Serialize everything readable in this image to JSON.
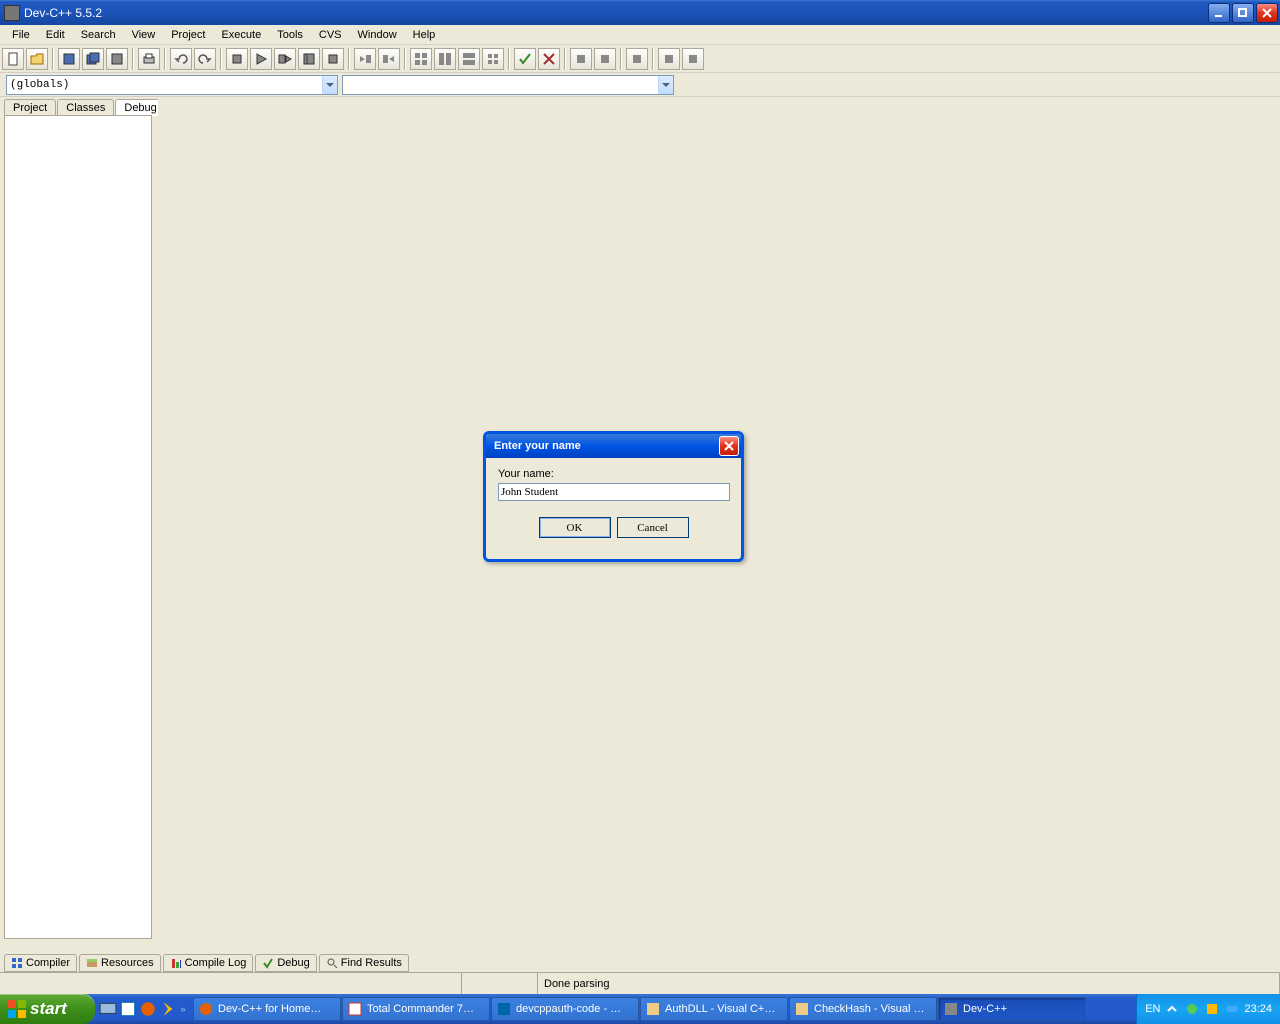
{
  "window": {
    "title": "Dev-C++ 5.5.2",
    "minimize": "_",
    "restore": "❐",
    "close": "×"
  },
  "menu": {
    "items": [
      "File",
      "Edit",
      "Search",
      "View",
      "Project",
      "Execute",
      "Tools",
      "CVS",
      "Window",
      "Help"
    ]
  },
  "toolbar2": {
    "globals": "(globals)",
    "second": ""
  },
  "sideTabs": {
    "project": "Project",
    "classes": "Classes",
    "debug": "Debug"
  },
  "bottomTabs": {
    "compiler": "Compiler",
    "resources": "Resources",
    "compileLog": "Compile Log",
    "debug": "Debug",
    "findResults": "Find Results"
  },
  "status": {
    "parsing": "Done parsing"
  },
  "dialog": {
    "title": "Enter your name",
    "label": "Your name:",
    "value": "John Student",
    "ok": "OK",
    "cancel": "Cancel"
  },
  "taskbar": {
    "start": "start",
    "items": [
      "Dev-C++ for Home…",
      "Total Commander 7…",
      "devcppauth-code - …",
      "AuthDLL - Visual C+…",
      "CheckHash - Visual …",
      "Dev-C++"
    ],
    "lang": "EN",
    "clock": "23:24"
  }
}
